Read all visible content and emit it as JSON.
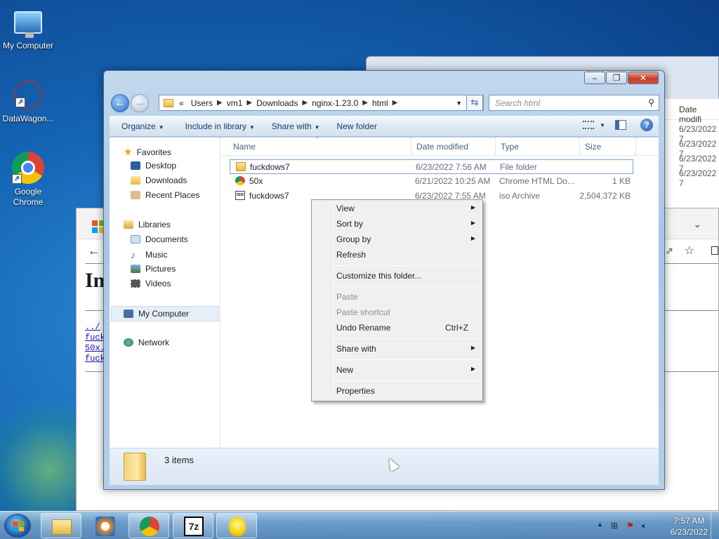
{
  "desktop": {
    "icons": [
      {
        "label": "My Computer"
      },
      {
        "label": "DataWagon..."
      },
      {
        "label": "Google Chrome"
      }
    ]
  },
  "background_windows": {
    "explorer_header": "Date modifi",
    "explorer_rows": [
      "6/23/2022 7",
      "6/23/2022 7",
      "6/23/2022 7",
      "6/23/2022 7"
    ],
    "browser_heading": "In",
    "browser_links": [
      "../",
      "fuck",
      "50x.",
      "fuck"
    ]
  },
  "explorer": {
    "address": {
      "overflow": "«",
      "crumbs": [
        "Users",
        "vm1",
        "Downloads",
        "nginx-1.23.0",
        "html"
      ]
    },
    "search_placeholder": "Search html",
    "toolbar": {
      "organize": "Organize",
      "include_in_library": "Include in library",
      "share_with": "Share with",
      "new_folder": "New folder"
    },
    "nav": {
      "favorites": "Favorites",
      "desktop": "Desktop",
      "downloads": "Downloads",
      "recent_places": "Recent Places",
      "libraries": "Libraries",
      "documents": "Documents",
      "music": "Music",
      "pictures": "Pictures",
      "videos": "Videos",
      "my_computer": "My Computer",
      "network": "Network"
    },
    "columns": {
      "name": "Name",
      "date_modified": "Date modified",
      "type": "Type",
      "size": "Size"
    },
    "files": [
      {
        "name": "fuckdows7",
        "date": "6/23/2022 7:56 AM",
        "type": "File folder",
        "size": ""
      },
      {
        "name": "50x",
        "date": "6/21/2022 10:25 AM",
        "type": "Chrome HTML Do...",
        "size": "1 KB"
      },
      {
        "name": "fuckdows7",
        "date": "6/23/2022 7:55 AM",
        "type": "iso Archive",
        "size": "2,504,372 KB"
      }
    ],
    "status": "3 items"
  },
  "context_menu": {
    "view": "View",
    "sort_by": "Sort by",
    "group_by": "Group by",
    "refresh": "Refresh",
    "customize": "Customize this folder...",
    "paste": "Paste",
    "paste_shortcut": "Paste shortcut",
    "undo_rename": "Undo Rename",
    "undo_shortcut": "Ctrl+Z",
    "share_with": "Share with",
    "new": "New",
    "properties": "Properties"
  },
  "taskbar": {
    "clock_time": "7:57 AM",
    "clock_date": "6/23/2022",
    "sevenzip_label": "7z"
  }
}
